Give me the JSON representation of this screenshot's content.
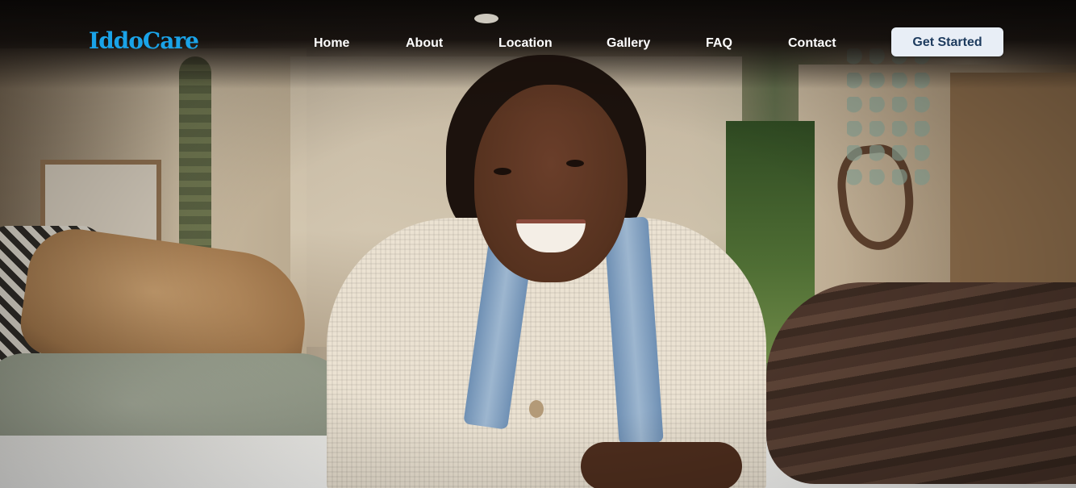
{
  "brand": {
    "logo_text": "IddoCare",
    "logo_color": "#1aa3e8"
  },
  "nav": {
    "items": [
      {
        "label": "Home"
      },
      {
        "label": "About"
      },
      {
        "label": "Location"
      },
      {
        "label": "Gallery"
      },
      {
        "label": "FAQ"
      },
      {
        "label": "Contact"
      }
    ],
    "cta_label": "Get Started",
    "cta_background": "#e8eef6",
    "cta_text_color": "#1d3b5e"
  },
  "hero": {
    "image_subject": "smiling-woman-in-camper-van"
  }
}
